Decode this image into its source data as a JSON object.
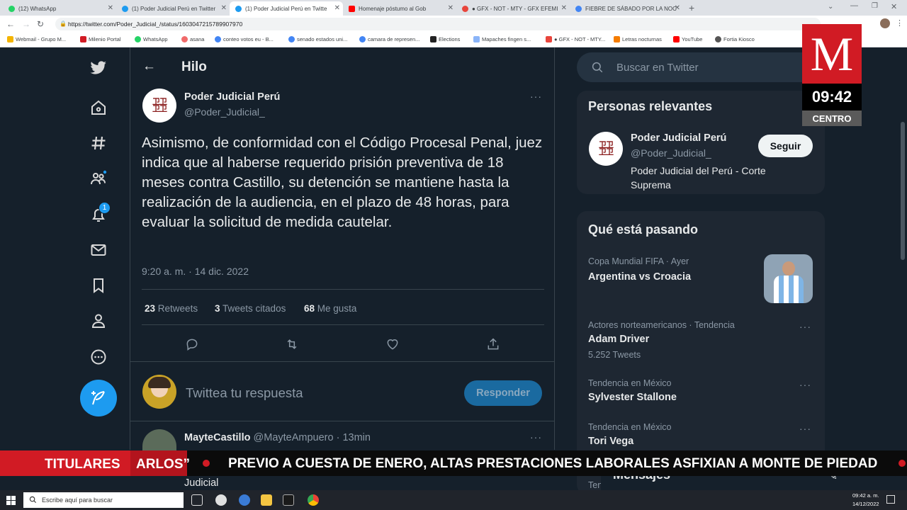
{
  "browser": {
    "tabs": [
      {
        "title": "(12) WhatsApp",
        "color": "#25d366"
      },
      {
        "title": "(1) Poder Judicial Perú en Twitter",
        "color": "#1d9bf0"
      },
      {
        "title": "(1) Poder Judicial Perú en Twitte",
        "color": "#1d9bf0"
      },
      {
        "title": "Homenaje póstumo al Gob",
        "color": "#ff0000"
      },
      {
        "title": "● GFX - NOT - MTY - GFX EFEMI",
        "color": "#e8453c"
      },
      {
        "title": "FIEBRE DE SÁBADO POR LA NOC",
        "color": "#4285f4"
      }
    ],
    "url": "https://twitter.com/Poder_Judicial_/status/1603047215789907970",
    "bookmarks": [
      "Webmail - Grupo M...",
      "Milenio Portal",
      "WhatsApp",
      "asana",
      "conteo votos eu - B...",
      "senado estados uni...",
      "camara de represen...",
      "Elections",
      "Mapaches fingen s...",
      "● GFX - NOT - MTY...",
      "Letras nocturnas",
      "YouTube",
      "Fortia Kiosco"
    ]
  },
  "header": {
    "title": "Hilo"
  },
  "tweet": {
    "author_name": "Poder Judicial Perú",
    "author_handle": "@Poder_Judicial_",
    "text": "Asimismo, de conformidad con el Código Procesal Penal, juez indica que al haberse requerido prisión preventiva de 18 meses contra Castillo, su detención se mantiene hasta la realización de la audiencia, en el plazo de 48 horas, para evaluar la solicitud de medida cautelar.",
    "timestamp": "9:20 a. m. · 14 dic. 2022",
    "stats": {
      "retweets_count": "23",
      "retweets_label": "Retweets",
      "quotes_count": "3",
      "quotes_label": "Tweets citados",
      "likes_count": "68",
      "likes_label": "Me gusta"
    }
  },
  "reply_box": {
    "placeholder": "Twittea tu respuesta",
    "button": "Responder"
  },
  "next_reply": {
    "name": "MayteCastillo",
    "handle": "@MayteAmpuero",
    "time": "· 13min",
    "partial_text": "Judicial"
  },
  "nav": {
    "notifications_badge": "1"
  },
  "search": {
    "placeholder": "Buscar en Twitter"
  },
  "relevant": {
    "title": "Personas relevantes",
    "name": "Poder Judicial Perú",
    "handle": "@Poder_Judicial_",
    "bio": "Poder Judicial del Perú - Corte Suprema",
    "follow_button": "Seguir"
  },
  "trends": {
    "title": "Qué está pasando",
    "items": [
      {
        "context": "Copa Mundial FIFA · Ayer",
        "name": "Argentina vs Croacia",
        "count": ""
      },
      {
        "context": "Actores norteamericanos · Tendencia",
        "name": "Adam Driver",
        "count": "5.252 Tweets"
      },
      {
        "context": "Tendencia en México",
        "name": "Sylvester Stallone",
        "count": ""
      },
      {
        "context": "Tendencia en México",
        "name": "Tori Vega",
        "count": ""
      }
    ],
    "partial_context": "Ten"
  },
  "messages": {
    "title": "Mensajes"
  },
  "overlay": {
    "logo": "M",
    "time": "09:42",
    "zone": "CENTRO",
    "ticker_label": "TITULARES",
    "ticker_cut": "ARLOS”",
    "ticker_text": "PREVIO A CUESTA DE ENERO, ALTAS PRESTACIONES LABORALES ASFIXIAN A MONTE DE PIEDAD",
    "brand_color": "#d11b24"
  },
  "taskbar": {
    "search_placeholder": "Escribe aquí para buscar",
    "clock_time": "09:42 a. m.",
    "clock_date": "14/12/2022"
  }
}
